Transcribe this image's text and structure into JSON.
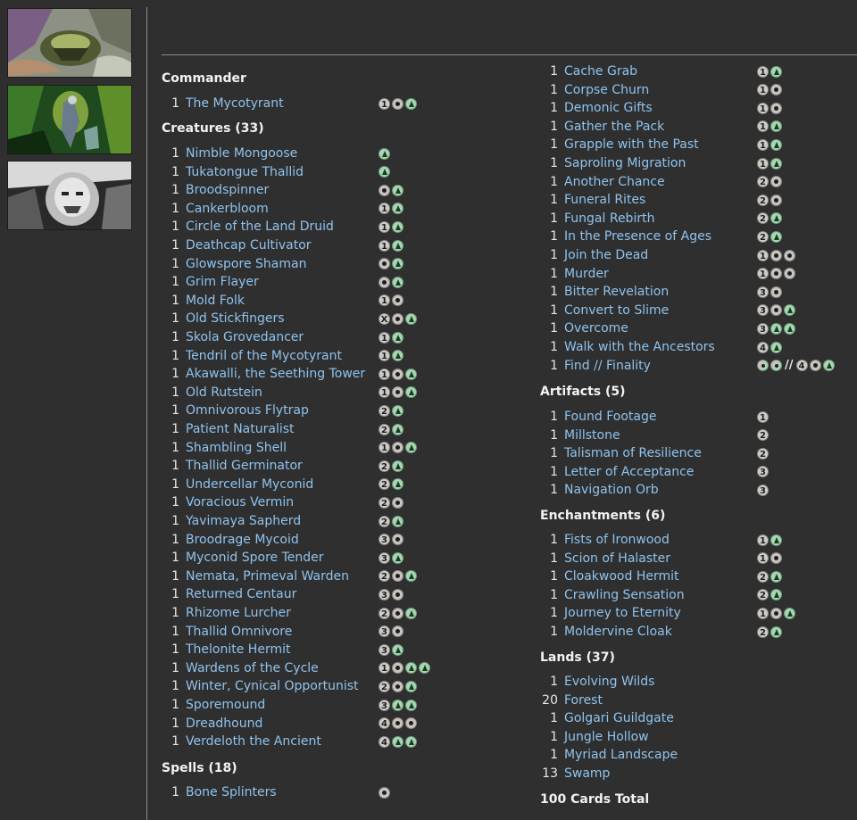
{
  "colors": {
    "background": "#2f2f2f",
    "link": "#8fc3ee",
    "text": "#e8e8e8",
    "divider": "#8c8c8c"
  },
  "sidebar": {
    "thumbnails": [
      {
        "name": "card-art-1"
      },
      {
        "name": "card-art-2"
      },
      {
        "name": "card-art-3"
      }
    ]
  },
  "sections_left": [
    {
      "title": "Commander",
      "cards": [
        {
          "qty": "1",
          "name": "The Mycotyrant",
          "cost": [
            "1",
            "B",
            "G"
          ]
        }
      ]
    },
    {
      "title": "Creatures (33)",
      "cards": [
        {
          "qty": "1",
          "name": "Nimble Mongoose",
          "cost": [
            "G"
          ]
        },
        {
          "qty": "1",
          "name": "Tukatongue Thallid",
          "cost": [
            "G"
          ]
        },
        {
          "qty": "1",
          "name": "Broodspinner",
          "cost": [
            "B",
            "G"
          ]
        },
        {
          "qty": "1",
          "name": "Cankerbloom",
          "cost": [
            "1",
            "G"
          ]
        },
        {
          "qty": "1",
          "name": "Circle of the Land Druid",
          "cost": [
            "1",
            "G"
          ]
        },
        {
          "qty": "1",
          "name": "Deathcap Cultivator",
          "cost": [
            "1",
            "G"
          ]
        },
        {
          "qty": "1",
          "name": "Glowspore Shaman",
          "cost": [
            "B",
            "G"
          ]
        },
        {
          "qty": "1",
          "name": "Grim Flayer",
          "cost": [
            "B",
            "G"
          ]
        },
        {
          "qty": "1",
          "name": "Mold Folk",
          "cost": [
            "1",
            "B"
          ]
        },
        {
          "qty": "1",
          "name": "Old Stickfingers",
          "cost": [
            "X",
            "B",
            "G"
          ]
        },
        {
          "qty": "1",
          "name": "Skola Grovedancer",
          "cost": [
            "1",
            "G"
          ]
        },
        {
          "qty": "1",
          "name": "Tendril of the Mycotyrant",
          "cost": [
            "1",
            "G"
          ]
        },
        {
          "qty": "1",
          "name": "Akawalli, the Seething Tower",
          "cost": [
            "1",
            "B",
            "G"
          ]
        },
        {
          "qty": "1",
          "name": "Old Rutstein",
          "cost": [
            "1",
            "B",
            "G"
          ]
        },
        {
          "qty": "1",
          "name": "Omnivorous Flytrap",
          "cost": [
            "2",
            "G"
          ]
        },
        {
          "qty": "1",
          "name": "Patient Naturalist",
          "cost": [
            "2",
            "G"
          ]
        },
        {
          "qty": "1",
          "name": "Shambling Shell",
          "cost": [
            "1",
            "B",
            "G"
          ]
        },
        {
          "qty": "1",
          "name": "Thallid Germinator",
          "cost": [
            "2",
            "G"
          ]
        },
        {
          "qty": "1",
          "name": "Undercellar Myconid",
          "cost": [
            "2",
            "G"
          ]
        },
        {
          "qty": "1",
          "name": "Voracious Vermin",
          "cost": [
            "2",
            "B"
          ]
        },
        {
          "qty": "1",
          "name": "Yavimaya Sapherd",
          "cost": [
            "2",
            "G"
          ]
        },
        {
          "qty": "1",
          "name": "Broodrage Mycoid",
          "cost": [
            "3",
            "B"
          ]
        },
        {
          "qty": "1",
          "name": "Myconid Spore Tender",
          "cost": [
            "3",
            "G"
          ]
        },
        {
          "qty": "1",
          "name": "Nemata, Primeval Warden",
          "cost": [
            "2",
            "B",
            "G"
          ]
        },
        {
          "qty": "1",
          "name": "Returned Centaur",
          "cost": [
            "3",
            "B"
          ]
        },
        {
          "qty": "1",
          "name": "Rhizome Lurcher",
          "cost": [
            "2",
            "B",
            "G"
          ]
        },
        {
          "qty": "1",
          "name": "Thallid Omnivore",
          "cost": [
            "3",
            "B"
          ]
        },
        {
          "qty": "1",
          "name": "Thelonite Hermit",
          "cost": [
            "3",
            "G"
          ]
        },
        {
          "qty": "1",
          "name": "Wardens of the Cycle",
          "cost": [
            "1",
            "B",
            "G",
            "G"
          ]
        },
        {
          "qty": "1",
          "name": "Winter, Cynical Opportunist",
          "cost": [
            "2",
            "B",
            "G"
          ]
        },
        {
          "qty": "1",
          "name": "Sporemound",
          "cost": [
            "3",
            "G",
            "G"
          ]
        },
        {
          "qty": "1",
          "name": "Dreadhound",
          "cost": [
            "4",
            "B",
            "B"
          ]
        },
        {
          "qty": "1",
          "name": "Verdeloth the Ancient",
          "cost": [
            "4",
            "G",
            "G"
          ]
        }
      ]
    },
    {
      "title": "Spells (18)",
      "cards": [
        {
          "qty": "1",
          "name": "Bone Splinters",
          "cost": [
            "B"
          ]
        }
      ]
    }
  ],
  "spells_continued": [
    {
      "qty": "1",
      "name": "Cache Grab",
      "cost": [
        "1",
        "G"
      ]
    },
    {
      "qty": "1",
      "name": "Corpse Churn",
      "cost": [
        "1",
        "B"
      ]
    },
    {
      "qty": "1",
      "name": "Demonic Gifts",
      "cost": [
        "1",
        "B"
      ]
    },
    {
      "qty": "1",
      "name": "Gather the Pack",
      "cost": [
        "1",
        "G"
      ]
    },
    {
      "qty": "1",
      "name": "Grapple with the Past",
      "cost": [
        "1",
        "G"
      ]
    },
    {
      "qty": "1",
      "name": "Saproling Migration",
      "cost": [
        "1",
        "G"
      ]
    },
    {
      "qty": "1",
      "name": "Another Chance",
      "cost": [
        "2",
        "B"
      ]
    },
    {
      "qty": "1",
      "name": "Funeral Rites",
      "cost": [
        "2",
        "B"
      ]
    },
    {
      "qty": "1",
      "name": "Fungal Rebirth",
      "cost": [
        "2",
        "G"
      ]
    },
    {
      "qty": "1",
      "name": "In the Presence of Ages",
      "cost": [
        "2",
        "G"
      ]
    },
    {
      "qty": "1",
      "name": "Join the Dead",
      "cost": [
        "1",
        "B",
        "B"
      ]
    },
    {
      "qty": "1",
      "name": "Murder",
      "cost": [
        "1",
        "B",
        "B"
      ]
    },
    {
      "qty": "1",
      "name": "Bitter Revelation",
      "cost": [
        "3",
        "B"
      ]
    },
    {
      "qty": "1",
      "name": "Convert to Slime",
      "cost": [
        "3",
        "B",
        "G"
      ]
    },
    {
      "qty": "1",
      "name": "Overcome",
      "cost": [
        "3",
        "G",
        "G"
      ]
    },
    {
      "qty": "1",
      "name": "Walk with the Ancestors",
      "cost": [
        "4",
        "G"
      ]
    },
    {
      "qty": "1",
      "name": "Find // Finality",
      "cost": [
        "BG",
        "BG",
        "//",
        "4",
        "B",
        "G"
      ]
    }
  ],
  "sections_right": [
    {
      "title": "Artifacts (5)",
      "cards": [
        {
          "qty": "1",
          "name": "Found Footage",
          "cost": [
            "1"
          ]
        },
        {
          "qty": "1",
          "name": "Millstone",
          "cost": [
            "2"
          ]
        },
        {
          "qty": "1",
          "name": "Talisman of Resilience",
          "cost": [
            "2"
          ]
        },
        {
          "qty": "1",
          "name": "Letter of Acceptance",
          "cost": [
            "3"
          ]
        },
        {
          "qty": "1",
          "name": "Navigation Orb",
          "cost": [
            "3"
          ]
        }
      ]
    },
    {
      "title": "Enchantments (6)",
      "cards": [
        {
          "qty": "1",
          "name": "Fists of Ironwood",
          "cost": [
            "1",
            "G"
          ]
        },
        {
          "qty": "1",
          "name": "Scion of Halaster",
          "cost": [
            "1",
            "B"
          ]
        },
        {
          "qty": "1",
          "name": "Cloakwood Hermit",
          "cost": [
            "2",
            "G"
          ]
        },
        {
          "qty": "1",
          "name": "Crawling Sensation",
          "cost": [
            "2",
            "G"
          ]
        },
        {
          "qty": "1",
          "name": "Journey to Eternity",
          "cost": [
            "1",
            "B",
            "G"
          ]
        },
        {
          "qty": "1",
          "name": "Moldervine Cloak",
          "cost": [
            "2",
            "G"
          ]
        }
      ]
    },
    {
      "title": "Lands (37)",
      "cards": [
        {
          "qty": "1",
          "name": "Evolving Wilds",
          "cost": []
        },
        {
          "qty": "20",
          "name": "Forest",
          "cost": []
        },
        {
          "qty": "1",
          "name": "Golgari Guildgate",
          "cost": []
        },
        {
          "qty": "1",
          "name": "Jungle Hollow",
          "cost": []
        },
        {
          "qty": "1",
          "name": "Myriad Landscape",
          "cost": []
        },
        {
          "qty": "13",
          "name": "Swamp",
          "cost": []
        }
      ]
    }
  ],
  "total_label": "100 Cards Total"
}
